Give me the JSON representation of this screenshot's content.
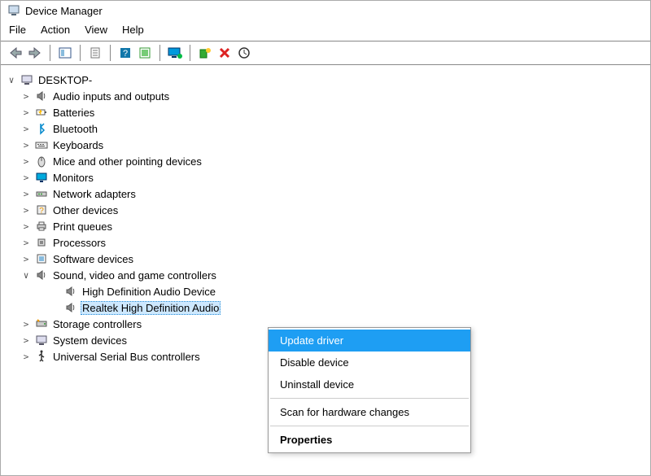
{
  "window": {
    "title": "Device Manager"
  },
  "menubar": {
    "items": [
      "File",
      "Action",
      "View",
      "Help"
    ]
  },
  "toolbar": {
    "buttons": [
      "back",
      "forward",
      "sep",
      "show-hide-tree",
      "sep",
      "properties",
      "sep",
      "help",
      "update-driver",
      "sep",
      "monitor",
      "sep",
      "add-hardware",
      "remove",
      "scan"
    ]
  },
  "tree": {
    "root": {
      "label": "DESKTOP-",
      "expanded": true
    },
    "children": [
      {
        "label": "Audio inputs and outputs",
        "icon": "speaker",
        "expandable": true
      },
      {
        "label": "Batteries",
        "icon": "battery",
        "expandable": true
      },
      {
        "label": "Bluetooth",
        "icon": "bluetooth",
        "expandable": true
      },
      {
        "label": "Keyboards",
        "icon": "keyboard",
        "expandable": true
      },
      {
        "label": "Mice and other pointing devices",
        "icon": "mouse",
        "expandable": true
      },
      {
        "label": "Monitors",
        "icon": "monitor",
        "expandable": true
      },
      {
        "label": "Network adapters",
        "icon": "network",
        "expandable": true
      },
      {
        "label": "Other devices",
        "icon": "other",
        "expandable": true
      },
      {
        "label": "Print queues",
        "icon": "printer",
        "expandable": true
      },
      {
        "label": "Processors",
        "icon": "cpu",
        "expandable": true
      },
      {
        "label": "Software devices",
        "icon": "software",
        "expandable": true
      },
      {
        "label": "Sound, video and game controllers",
        "icon": "speaker",
        "expandable": true,
        "expanded": true,
        "children": [
          {
            "label": "High Definition Audio Device",
            "icon": "speaker"
          },
          {
            "label": "Realtek High Definition Audio",
            "icon": "speaker",
            "selected": true
          }
        ]
      },
      {
        "label": "Storage controllers",
        "icon": "storage",
        "expandable": true
      },
      {
        "label": "System devices",
        "icon": "system",
        "expandable": true
      },
      {
        "label": "Universal Serial Bus controllers",
        "icon": "usb",
        "expandable": true
      }
    ]
  },
  "context_menu": {
    "items": [
      {
        "label": "Update driver",
        "highlight": true
      },
      {
        "label": "Disable device"
      },
      {
        "label": "Uninstall device"
      },
      {
        "sep": true
      },
      {
        "label": "Scan for hardware changes"
      },
      {
        "sep": true
      },
      {
        "label": "Properties",
        "bold": true
      }
    ]
  }
}
